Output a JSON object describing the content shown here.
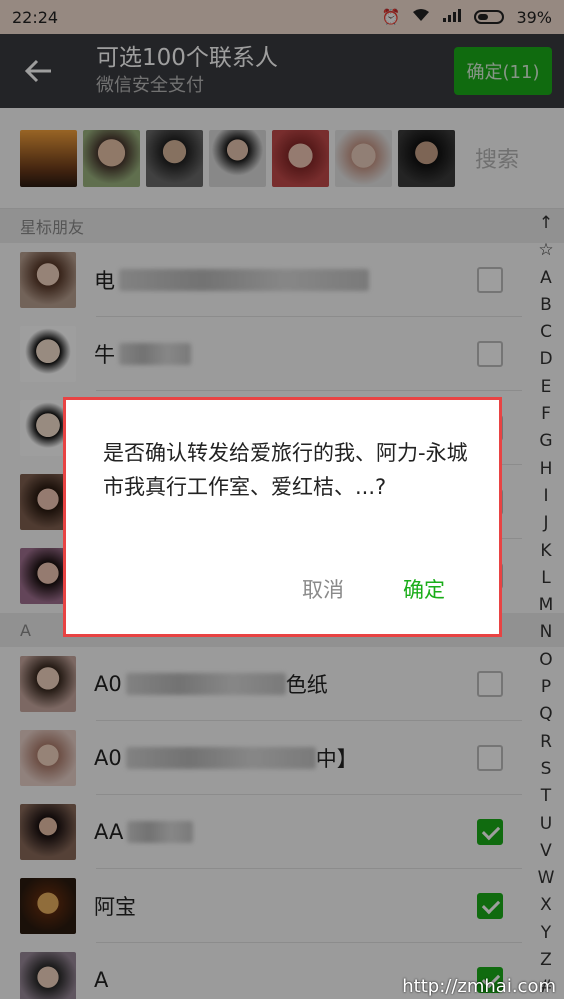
{
  "status_bar": {
    "time": "22:24",
    "battery": "39%"
  },
  "header": {
    "title": "可选100个联系人",
    "subtitle": "微信安全支付",
    "confirm_label": "确定(11)"
  },
  "selected": {
    "search_placeholder": "搜索"
  },
  "sections": {
    "starred": "星标朋友",
    "a": "A"
  },
  "contacts": [
    {
      "name": "电",
      "checked": false
    },
    {
      "name": "牛",
      "checked": false
    },
    {
      "name": "",
      "checked": false
    },
    {
      "name": "",
      "checked": false
    },
    {
      "name": "",
      "checked": false
    },
    {
      "name": "A0",
      "suffix": "色纸",
      "checked": false
    },
    {
      "name": "A0",
      "suffix": "中】",
      "checked": false
    },
    {
      "name": "AA",
      "checked": true
    },
    {
      "name": "阿宝",
      "checked": true
    },
    {
      "name": "A",
      "checked": true
    }
  ],
  "index_letters": [
    "↑",
    "☆",
    "A",
    "B",
    "C",
    "D",
    "E",
    "F",
    "G",
    "H",
    "I",
    "J",
    "K",
    "L",
    "M",
    "N",
    "O",
    "P",
    "Q",
    "R",
    "S",
    "T",
    "U",
    "V",
    "W",
    "X",
    "Y",
    "Z",
    "#"
  ],
  "dialog": {
    "message": "是否确认转发给爱旅行的我、阿力-永城市我真行工作室、爱红桔、...?",
    "cancel": "取消",
    "ok": "确定"
  },
  "watermark": "http://zmhai.com"
}
